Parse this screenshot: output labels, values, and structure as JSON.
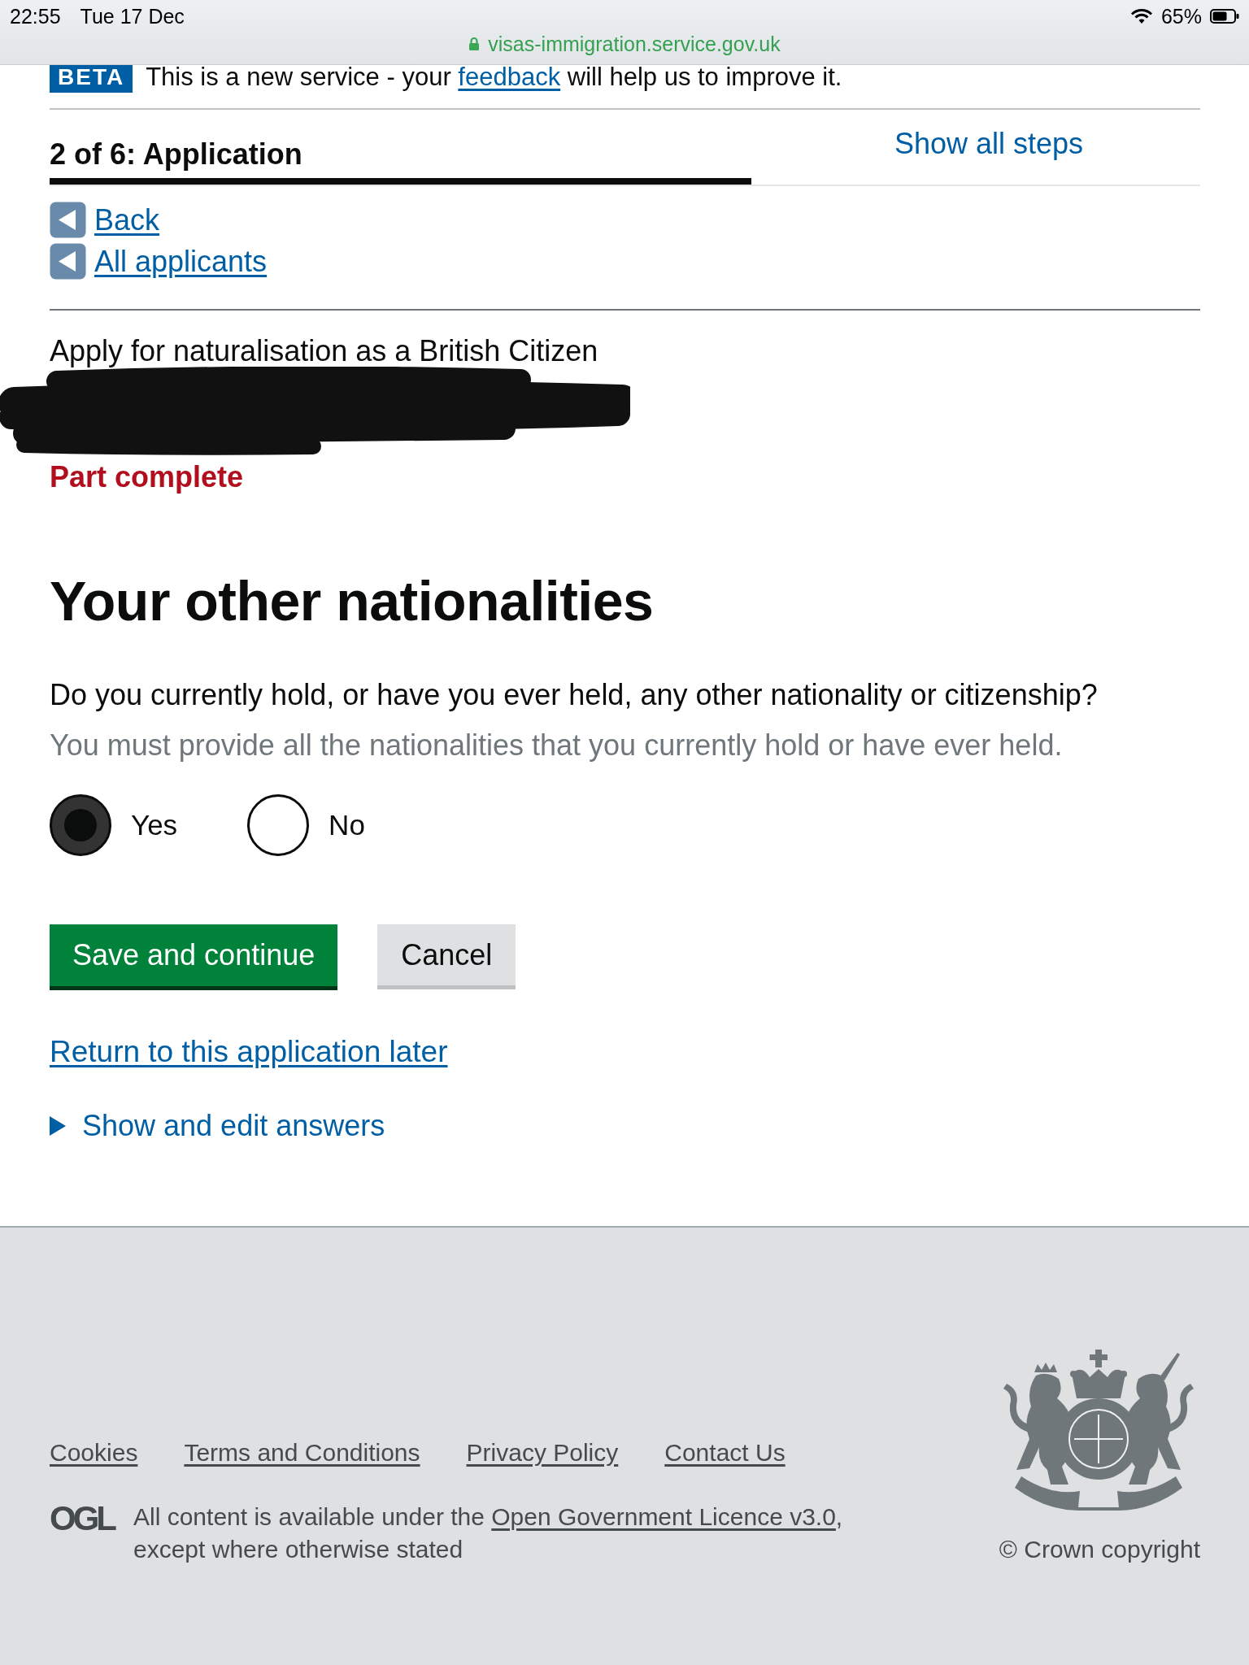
{
  "status_bar": {
    "time": "22:55",
    "date": "Tue 17 Dec",
    "url": "visas-immigration.service.gov.uk",
    "battery": "65%"
  },
  "beta_banner": {
    "tag": "BETA",
    "text_before": "This is a new service - your ",
    "link": "feedback",
    "text_after": " will help us to improve it."
  },
  "progress": {
    "label": "2 of 6: Application",
    "show_all_steps": "Show all steps",
    "level": 0.61
  },
  "nav_links": [
    {
      "label": "Back"
    },
    {
      "label": "All applicants"
    }
  ],
  "application": {
    "title": "Apply for naturalisation as a British Citizen",
    "redaction_mark": true,
    "status": "Part complete"
  },
  "heading": "Your other nationalities",
  "question": {
    "text": "Do you currently hold, or have you ever held, any other nationality or citizenship?",
    "hint": "You must provide all the nationalities that you currently hold or have ever held.",
    "options": [
      {
        "label": "Yes",
        "selected": true
      },
      {
        "label": "No",
        "selected": false
      }
    ]
  },
  "buttons": [
    {
      "label": "Save and continue",
      "kind": "primary"
    },
    {
      "label": "Cancel",
      "kind": "secondary"
    }
  ],
  "return_link": "Return to this application later",
  "details": {
    "label": "Show and edit answers",
    "expanded": false
  },
  "footer": {
    "links": [
      "Cookies",
      "Terms and Conditions",
      "Privacy Policy",
      "Contact Us"
    ],
    "licence": {
      "logo": "OGL",
      "text_before": "All content is available under the ",
      "link": "Open Government Licence v3.0",
      "text_after": ", except where otherwise stated"
    },
    "copyright": "© Crown copyright"
  }
}
